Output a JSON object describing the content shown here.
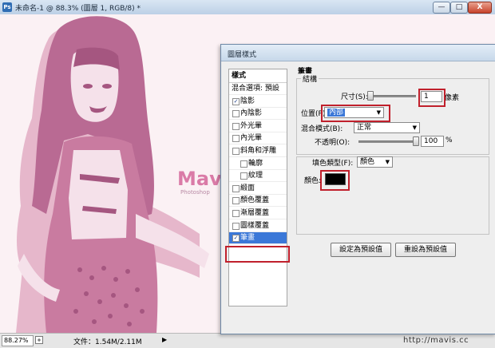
{
  "window": {
    "title": "未命名-1 @ 88.3% (圖層 1, RGB/8) *",
    "app_icon": "Ps",
    "controls": {
      "minimize": "—",
      "maximize": "□",
      "close": "X"
    }
  },
  "status": {
    "zoom": "88.27%",
    "file_info": "文件：1.54M/2.11M",
    "arrow": "▶",
    "watermark": "http://mavis.cc"
  },
  "canvas": {
    "mark": "Mavis",
    "mark_sub": "Photoshop"
  },
  "dialog": {
    "title": "圖層樣式",
    "list": {
      "header": "樣式",
      "items": [
        {
          "label": "混合選項: 預設",
          "checkbox": false,
          "checked": false,
          "indent": false,
          "selected": false
        },
        {
          "label": "陰影",
          "checkbox": true,
          "checked": true,
          "indent": false,
          "selected": false
        },
        {
          "label": "內陰影",
          "checkbox": true,
          "checked": false,
          "indent": false,
          "selected": false
        },
        {
          "label": "外光暈",
          "checkbox": true,
          "checked": false,
          "indent": false,
          "selected": false
        },
        {
          "label": "內光暈",
          "checkbox": true,
          "checked": false,
          "indent": false,
          "selected": false
        },
        {
          "label": "斜角和浮雕",
          "checkbox": true,
          "checked": false,
          "indent": false,
          "selected": false
        },
        {
          "label": "輪廓",
          "checkbox": true,
          "checked": false,
          "indent": true,
          "selected": false
        },
        {
          "label": "紋理",
          "checkbox": true,
          "checked": false,
          "indent": true,
          "selected": false
        },
        {
          "label": "緞面",
          "checkbox": true,
          "checked": false,
          "indent": false,
          "selected": false
        },
        {
          "label": "顏色覆蓋",
          "checkbox": true,
          "checked": false,
          "indent": false,
          "selected": false
        },
        {
          "label": "漸層覆蓋",
          "checkbox": true,
          "checked": false,
          "indent": false,
          "selected": false
        },
        {
          "label": "圖樣覆蓋",
          "checkbox": true,
          "checked": false,
          "indent": false,
          "selected": false
        },
        {
          "label": "筆畫",
          "checkbox": true,
          "checked": true,
          "indent": false,
          "selected": true
        }
      ]
    },
    "stroke": {
      "title": "筆畫",
      "structure_label": "結構",
      "size_label": "尺寸(S):",
      "size_value": "1",
      "size_unit": "像素",
      "position_label": "位置(P):",
      "position_value": "內部",
      "blend_label": "混合模式(B):",
      "blend_value": "正常",
      "opacity_label": "不透明(O):",
      "opacity_value": "100",
      "opacity_unit": "%",
      "opacity_level": 1.0,
      "fill_type_label": "填色類型(F):",
      "fill_type_value": "顏色",
      "color_label": "顏色:",
      "color_value": "#000000"
    },
    "buttons": {
      "make_default": "設定為預設值",
      "reset_default": "重設為預設值"
    }
  },
  "colors": {
    "pink_light": "#f2d6e1",
    "pink_mid": "#c97ba0",
    "pink_dark": "#a55680",
    "selection": "#3b78d8",
    "highlight_red": "#c0202c"
  }
}
